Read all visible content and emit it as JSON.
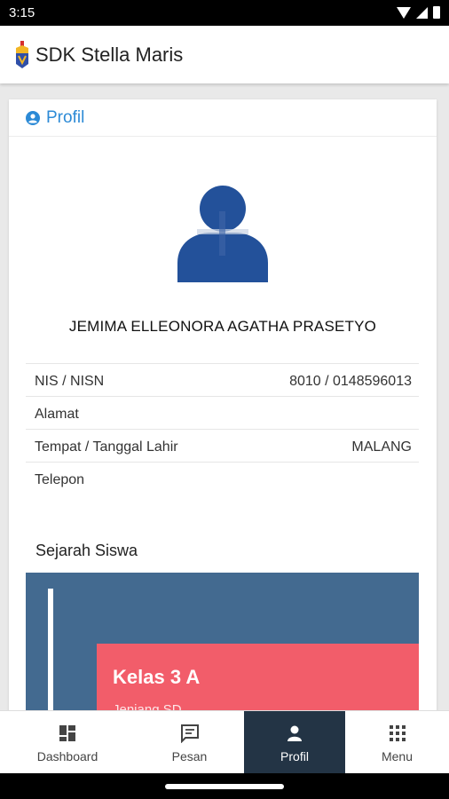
{
  "status_bar": {
    "time": "3:15"
  },
  "app_bar": {
    "title": "SDK Stella Maris"
  },
  "profile_card": {
    "header_title": "Profil",
    "student_name": "JEMIMA ELLEONORA AGATHA PRASETYO",
    "fields": [
      {
        "label": "NIS / NISN",
        "value": "8010 / 0148596013"
      },
      {
        "label": "Alamat",
        "value": ""
      },
      {
        "label": "Tempat / Tanggal Lahir",
        "value": "MALANG"
      },
      {
        "label": "Telepon",
        "value": ""
      }
    ]
  },
  "history": {
    "title": "Sejarah Siswa",
    "entries": [
      {
        "class": "Kelas 3 A",
        "subtitle": "Jenjang SD"
      }
    ]
  },
  "bottom_nav": {
    "items": [
      {
        "label": "Dashboard",
        "icon": "dashboard-icon"
      },
      {
        "label": "Pesan",
        "icon": "message-icon"
      },
      {
        "label": "Profil",
        "icon": "person-icon",
        "active": true
      },
      {
        "label": "Menu",
        "icon": "grid-icon"
      }
    ]
  },
  "colors": {
    "accent": "#2c8ad6",
    "avatar": "#23519a",
    "timeline_bg": "#436a90",
    "entry_bg": "#f25d6a",
    "nav_active": "#233445"
  }
}
